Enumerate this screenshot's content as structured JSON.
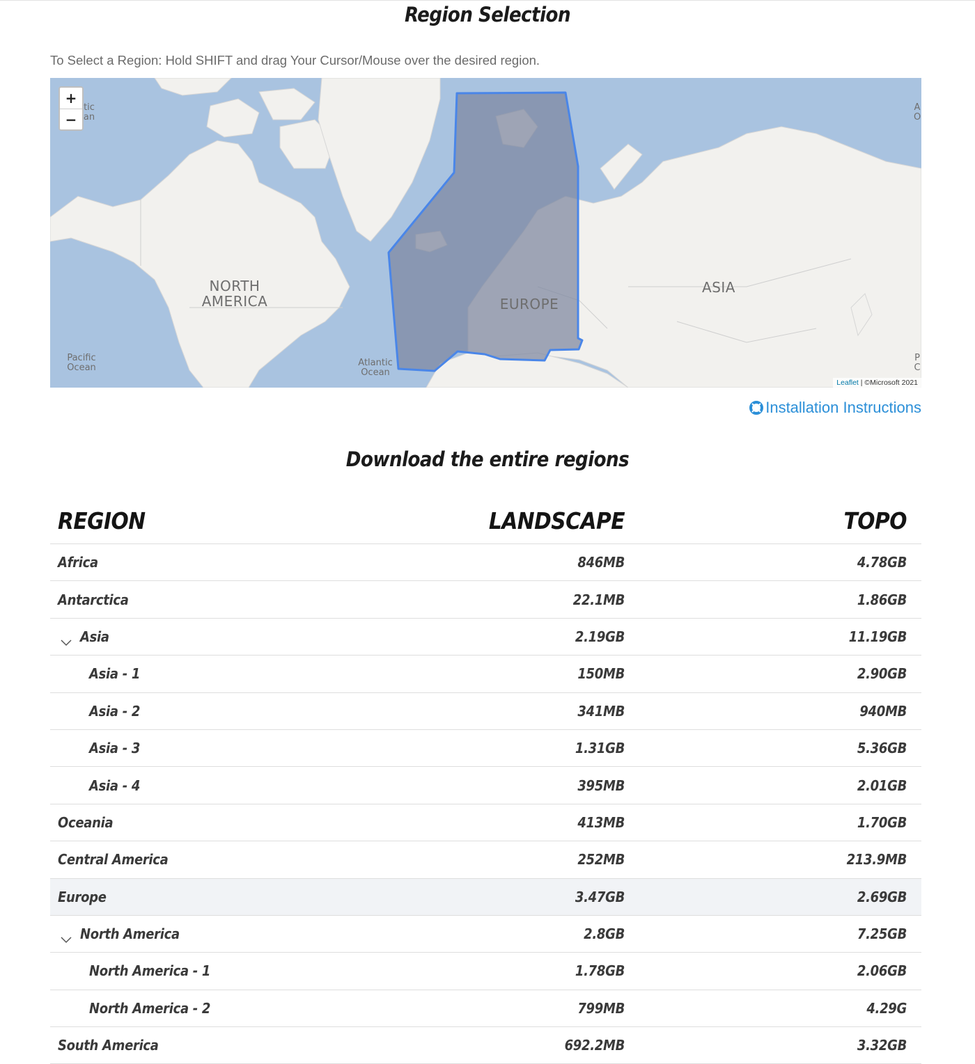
{
  "header": {
    "title": "Region Selection",
    "instructions": "To Select a Region: Hold SHIFT and drag Your Cursor/Mouse over the desired region."
  },
  "map": {
    "zoom_in": "+",
    "zoom_out": "−",
    "labels": {
      "north_america": "NORTH AMERICA",
      "europe": "EUROPE",
      "asia": "ASIA",
      "atlantic": "Atlantic Ocean",
      "pacific_left": "Pacific Ocean",
      "arctic_partial": "tic an",
      "right_edge_top": "A O",
      "right_edge_bottom": "P C"
    },
    "attribution_leaflet": "Leaflet",
    "attribution_sep": " | ",
    "attribution_provider": "©Microsoft 2021",
    "selection_color": "#4a86e8",
    "selection_fill": "#7d869f"
  },
  "install_link": {
    "label": "Installation Instructions",
    "color": "#2b8fd8"
  },
  "downloads": {
    "title": "Download the entire regions",
    "columns": {
      "region": "REGION",
      "landscape": "LANDSCAPE",
      "topo": "TOPO"
    },
    "rows": [
      {
        "region": "Africa",
        "landscape": "846MB",
        "topo": "4.78GB"
      },
      {
        "region": "Antarctica",
        "landscape": "22.1MB",
        "topo": "1.86GB"
      },
      {
        "region": "Asia",
        "landscape": "2.19GB",
        "topo": "11.19GB"
      },
      {
        "region": "Asia - 1",
        "landscape": "150MB",
        "topo": "2.90GB"
      },
      {
        "region": "Asia - 2",
        "landscape": "341MB",
        "topo": "940MB"
      },
      {
        "region": "Asia - 3",
        "landscape": "1.31GB",
        "topo": "5.36GB"
      },
      {
        "region": "Asia - 4",
        "landscape": "395MB",
        "topo": "2.01GB"
      },
      {
        "region": "Oceania",
        "landscape": "413MB",
        "topo": "1.70GB"
      },
      {
        "region": "Central America",
        "landscape": "252MB",
        "topo": "213.9MB"
      },
      {
        "region": "Europe",
        "landscape": "3.47GB",
        "topo": "2.69GB"
      },
      {
        "region": "North America",
        "landscape": "2.8GB",
        "topo": "7.25GB"
      },
      {
        "region": "North America - 1",
        "landscape": "1.78GB",
        "topo": "2.06GB"
      },
      {
        "region": "North America - 2",
        "landscape": "799MB",
        "topo": "4.29G"
      },
      {
        "region": "South America",
        "landscape": "692.2MB",
        "topo": "3.32GB"
      }
    ]
  }
}
